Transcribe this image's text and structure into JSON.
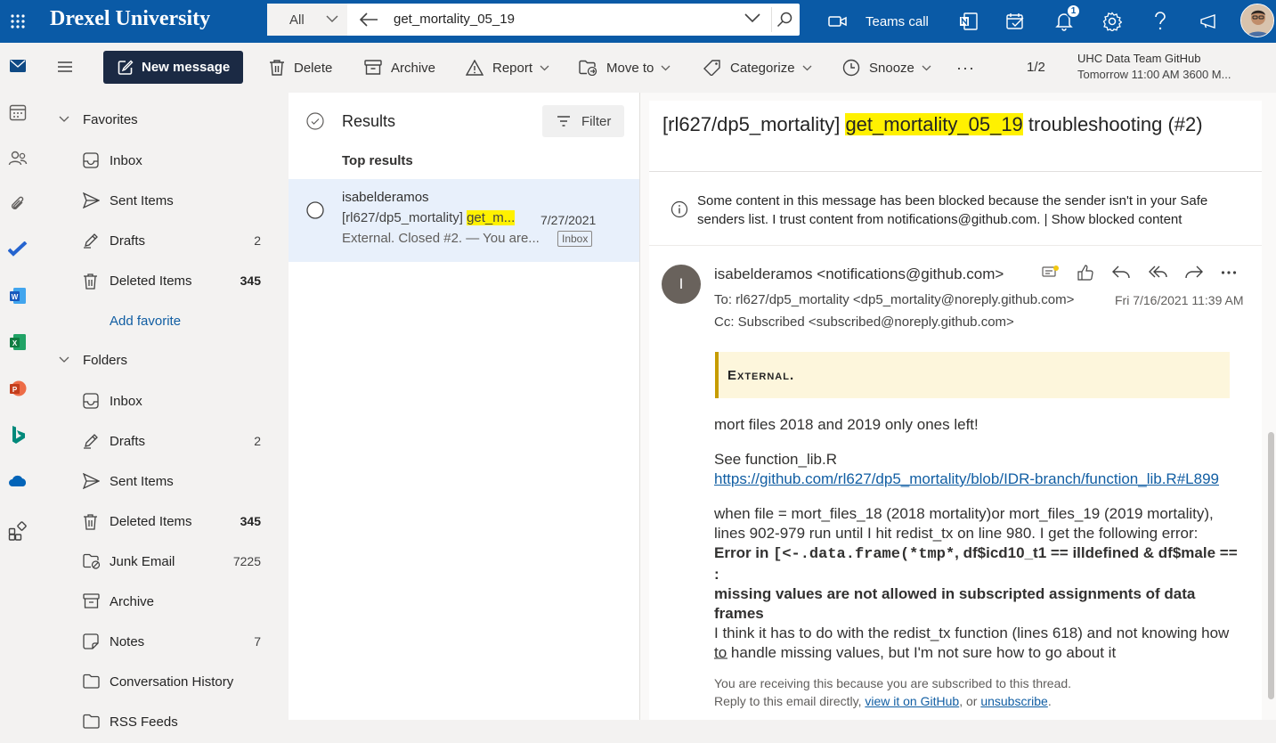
{
  "topbar": {
    "brand": "Drexel University",
    "search_scope": "All",
    "search_value": "get_mortality_05_19",
    "teams_call": "Teams call",
    "notification_count": "1"
  },
  "command_bar": {
    "new_message": "New message",
    "delete": "Delete",
    "archive": "Archive",
    "report": "Report",
    "move_to": "Move to",
    "categorize": "Categorize",
    "snooze": "Snooze",
    "more": "···",
    "upnext_count": "1/2",
    "upnext_title": "UHC Data Team GitHub",
    "upnext_subtitle": "Tomorrow 11:00 AM 3600 M..."
  },
  "folders": {
    "favorites_label": "Favorites",
    "favorites": [
      {
        "label": "Inbox",
        "count": ""
      },
      {
        "label": "Sent Items",
        "count": ""
      },
      {
        "label": "Drafts",
        "count": "2"
      },
      {
        "label": "Deleted Items",
        "count": "345"
      }
    ],
    "add_favorite": "Add favorite",
    "folders_label": "Folders",
    "folders": [
      {
        "label": "Inbox",
        "count": ""
      },
      {
        "label": "Drafts",
        "count": "2"
      },
      {
        "label": "Sent Items",
        "count": ""
      },
      {
        "label": "Deleted Items",
        "count": "345"
      },
      {
        "label": "Junk Email",
        "count": "7225"
      },
      {
        "label": "Archive",
        "count": ""
      },
      {
        "label": "Notes",
        "count": "7"
      },
      {
        "label": "Conversation History",
        "count": ""
      },
      {
        "label": "RSS Feeds",
        "count": ""
      }
    ]
  },
  "message_list": {
    "title": "Results",
    "filter": "Filter",
    "section": "Top results",
    "item": {
      "from": "isabelderamos",
      "subject_prefix": "[rl627/dp5_mortality] ",
      "subject_highlight": "get_m...",
      "date": "7/27/2021",
      "preview": "External. Closed #2. — You are...",
      "tag": "Inbox"
    }
  },
  "reading": {
    "subject_prefix": "[rl627/dp5_mortality] ",
    "subject_highlight": "get_mortality_05_19",
    "subject_suffix": " troubleshooting (#2)",
    "blocked_notice": "Some content in this message has been blocked because the sender isn't in your Safe senders list.",
    "trust_link": "I trust content from notifications@github.com.",
    "separator": "|",
    "show_blocked": "Show blocked content",
    "sender_initial": "I",
    "sender": "isabelderamos <notifications@github.com>",
    "to": "To:  rl627/dp5_mortality <dp5_mortality@noreply.github.com>",
    "cc": "Cc:  Subscribed <subscribed@noreply.github.com>",
    "date": "Fri 7/16/2021 11:39 AM",
    "external_banner": "External.",
    "para1": "mort files 2018 and 2019 only ones left!",
    "para2_line1": "See function_lib.R",
    "para2_link": "https://github.com/rl627/dp5_mortality/blob/IDR-branch/function_lib.R#L899",
    "para3": "when file = mort_files_18 (2018 mortality)or mort_files_19 (2019 mortality), lines 902-979 run until I hit redist_tx on line 980. I get the following error:",
    "error_prefix": "Error in ",
    "error_code": "[<-.data.frame(*tmp*",
    "error_suffix": ", df$icd10_t1 == illdefined & df$male == :",
    "error_line2": "missing values are not allowed in subscripted assignments of data frames",
    "para4": "I think it has to do with the redist_tx function (lines 618) and not knowing how to handle missing values, but I'm not sure how to go about it",
    "sig_sep": "—",
    "footer1": "You are receiving this because you are subscribed to this thread.",
    "footer2_prefix": "Reply to this email directly, ",
    "footer2_link1": "view it on GitHub",
    "footer2_mid": ", or ",
    "footer2_link2": "unsubscribe",
    "footer2_end": "."
  },
  "colors": {
    "topbar": "#0a5aa6",
    "new_message_bg": "#1b2a44",
    "highlight": "#fff100",
    "selected_item": "#e8f0fb",
    "link": "#115ea3"
  }
}
